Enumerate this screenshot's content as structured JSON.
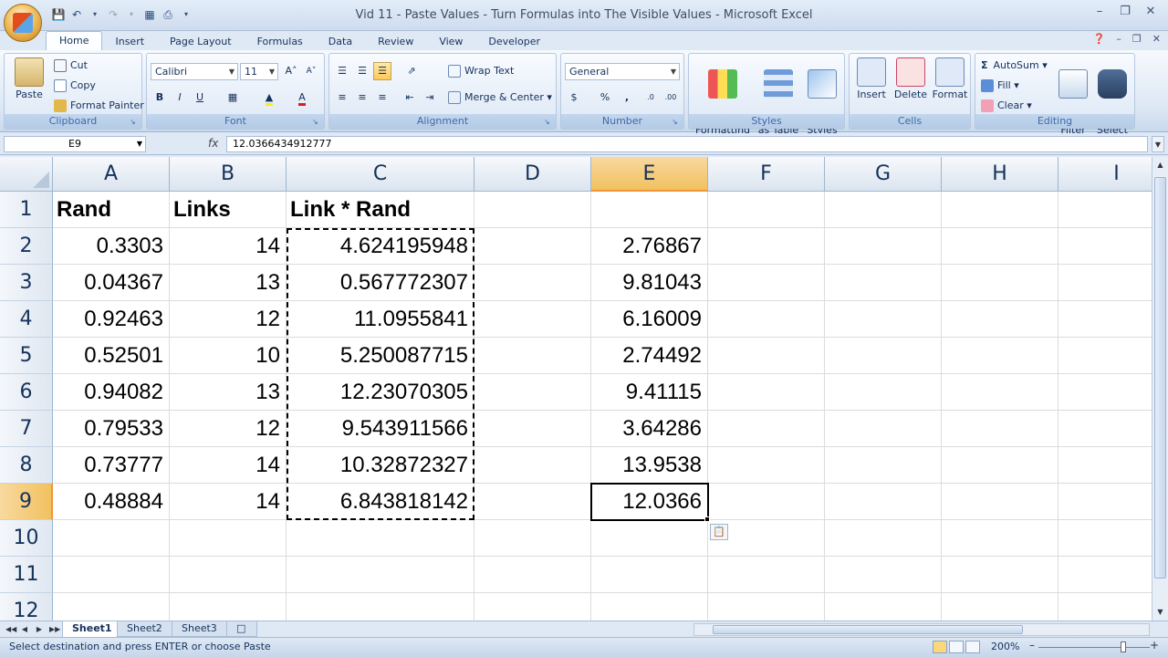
{
  "window": {
    "title": "Vid 11 - Paste Values - Turn Formulas into The Visible Values - Microsoft Excel"
  },
  "ribbon_tabs": [
    {
      "label": "Home",
      "active": true
    },
    {
      "label": "Insert"
    },
    {
      "label": "Page Layout"
    },
    {
      "label": "Formulas"
    },
    {
      "label": "Data"
    },
    {
      "label": "Review"
    },
    {
      "label": "View"
    },
    {
      "label": "Developer"
    }
  ],
  "ribbon": {
    "clipboard": {
      "label": "Clipboard",
      "paste": "Paste",
      "cut": "Cut",
      "copy": "Copy",
      "format_painter": "Format Painter"
    },
    "font": {
      "label": "Font",
      "font_name": "Calibri",
      "font_size": "11",
      "bold": "B",
      "italic": "I",
      "underline": "U"
    },
    "alignment": {
      "label": "Alignment",
      "wrap_text": "Wrap Text",
      "merge_center": "Merge & Center"
    },
    "number": {
      "label": "Number",
      "format": "General",
      "currency": "$",
      "percent": "%",
      "comma": ","
    },
    "styles": {
      "label": "Styles",
      "conditional": "Conditional\nFormatting",
      "format_table": "Format\nas Table",
      "cell_styles": "Cell\nStyles"
    },
    "cells": {
      "label": "Cells",
      "insert": "Insert",
      "delete": "Delete",
      "format": "Format"
    },
    "editing": {
      "label": "Editing",
      "autosum": "AutoSum",
      "fill": "Fill",
      "clear": "Clear",
      "sort_filter": "Sort &\nFilter",
      "find_select": "Find &\nSelect"
    }
  },
  "formula_bar": {
    "name_box": "E9",
    "fx": "fx",
    "formula": "12.0366434912777"
  },
  "columns": [
    "A",
    "B",
    "C",
    "D",
    "E",
    "F",
    "G",
    "H",
    "I"
  ],
  "rows": [
    "1",
    "2",
    "3",
    "4",
    "5",
    "6",
    "7",
    "8",
    "9",
    "10",
    "11",
    "12"
  ],
  "cells": {
    "A1": "Rand",
    "B1": "Links",
    "C1": "Link * Rand",
    "A2": "0.3303",
    "B2": "14",
    "C2": "4.624195948",
    "E2": "2.76867",
    "A3": "0.04367",
    "B3": "13",
    "C3": "0.567772307",
    "E3": "9.81043",
    "A4": "0.92463",
    "B4": "12",
    "C4": "11.0955841",
    "E4": "6.16009",
    "A5": "0.52501",
    "B5": "10",
    "C5": "5.250087715",
    "E5": "2.74492",
    "A6": "0.94082",
    "B6": "13",
    "C6": "12.23070305",
    "E6": "9.41115",
    "A7": "0.79533",
    "B7": "12",
    "C7": "9.543911566",
    "E7": "3.64286",
    "A8": "0.73777",
    "B8": "14",
    "C8": "10.32872327",
    "E8": "13.9538",
    "A9": "0.48884",
    "B9": "14",
    "C9": "6.843818142",
    "E9": "12.0366"
  },
  "sheets": [
    {
      "label": "Sheet1",
      "active": true
    },
    {
      "label": "Sheet2"
    },
    {
      "label": "Sheet3"
    }
  ],
  "status": {
    "message": "Select destination and press ENTER or choose Paste",
    "zoom": "200%"
  },
  "colors": {
    "selected_header": "#f1c15f",
    "ribbon_group_label": "#3e6aaa"
  }
}
